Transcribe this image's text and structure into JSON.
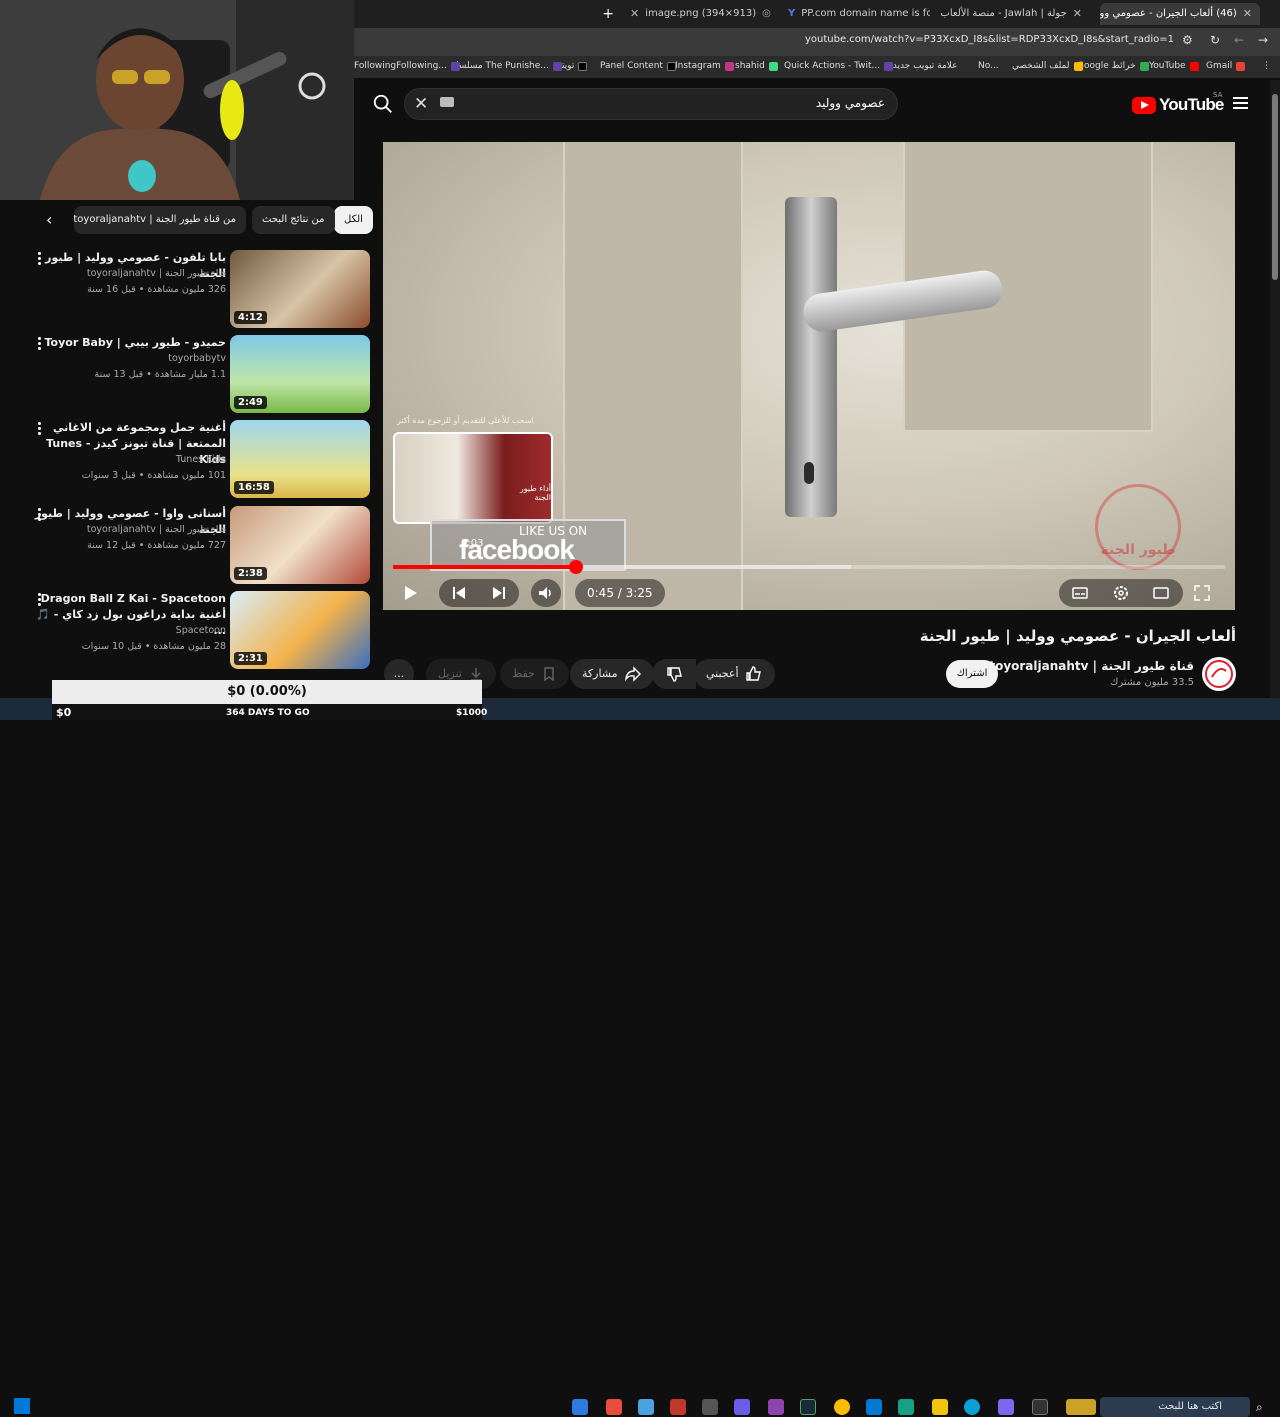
{
  "browser": {
    "tabs": [
      {
        "label": "(46) ألعاب الجيران - عصومي وو",
        "badge": "46",
        "active": true
      },
      {
        "label": "جولة | Jawlah - منصة الألعاب الت"
      },
      {
        "label": "PP.com domain name is for sale"
      },
      {
        "label": "image.png (394×913)"
      }
    ],
    "new_tab": "+",
    "url": "youtube.com/watch?v=P33XcxD_I8s&list=RDP33XcxD_I8s&start_radio=1",
    "bookmarks": [
      "Gmail",
      "YouTube",
      "Google خرائط",
      "لملف الشخصي",
      "No...",
      "علامة تبويب جديدة",
      "Quick Actions - Twit...",
      "shahid",
      "Instagram",
      "Panel Content",
      "تويتر",
      "مسلسل The Punishe...",
      "FollowingFollowing..."
    ]
  },
  "yt": {
    "logo_text": "YouTube",
    "country_code": "SA",
    "search_value": "عصومي ووليد"
  },
  "chips": [
    {
      "label": "الكل",
      "selected": true
    },
    {
      "label": "من نتائج البحث",
      "selected": false
    },
    {
      "label": "من قناة طيور الجنة | toyoraljanahtv",
      "selected": false
    }
  ],
  "playlist": [
    {
      "title": "بابا تلفون - عصومي ووليد | طيور الجنة",
      "channel": "قناة طيور الجنة | toyoraljanahtv",
      "meta": "326 مليون مشاهدة • قبل 16 سنة",
      "duration": "4:12"
    },
    {
      "title": "حميدو - طيور بيبي | Toyor Baby",
      "channel": "toyorbabytv",
      "meta": "1.1 مليار مشاهدة • قبل 13 سنة",
      "duration": "2:49"
    },
    {
      "title": "أغنية جمل ومجموعة من الاغاني الممتعة | قناة تيونز كيدز - Tunes Kids",
      "channel": "Tunes Kids",
      "meta": "101 مليون مشاهدة • قبل 3 سنوات",
      "duration": "16:58"
    },
    {
      "title": "أسنانى واوا - عصومي ووليد | طيور الجنة",
      "channel": "قناة طيور الجنة | toyoraljanahtv",
      "meta": "727 مليون مشاهدة • قبل 12 سنة",
      "duration": "2:38"
    },
    {
      "title": "Dragon Ball Z Kai - Spacetoon أغنية بداية دراغون بول زد كاي - 🎵 ...",
      "channel": "Spacetoon",
      "meta": "28 مليون مشاهدة • قبل 10 سنوات",
      "duration": "2:31"
    }
  ],
  "player": {
    "current_time": "0:45",
    "duration": "3:25",
    "time_display": "0:45 / 3:25",
    "preview_time": "0:03",
    "preview_hint": "اسحب للأعلى للتقديم أو للرجوع مدة أكثر",
    "progress_fraction": 0.22,
    "buffer_fraction": 0.55,
    "watermark_text": "طيور الجنة",
    "overlay_like": "LIKE US ON",
    "overlay_brand": "facebook",
    "preview_caption": "أداء طيور الجنة"
  },
  "video": {
    "title": "ألعاب الجيران - عصومي ووليد | طيور الجنة",
    "channel": "قناة طيور الجنة | toyoraljanahtv",
    "subscribers": "33.5 مليون مشترك",
    "subscribe_label": "اشتراك",
    "like_label": "أعجبني",
    "share_label": "مشاركة",
    "save_label": "حفظ",
    "download_label": "تنزيل",
    "more_label": "..."
  },
  "overlay": {
    "donation": "$0 (0.00%)",
    "days_text": "364 DAYS TO GO",
    "start_amount": "$0",
    "goal": "$1000"
  },
  "taskbar": {
    "search_placeholder": "اكتب هنا للبحث"
  },
  "colors": {
    "accent": "#ff0000",
    "background": "#0f0f0f"
  }
}
